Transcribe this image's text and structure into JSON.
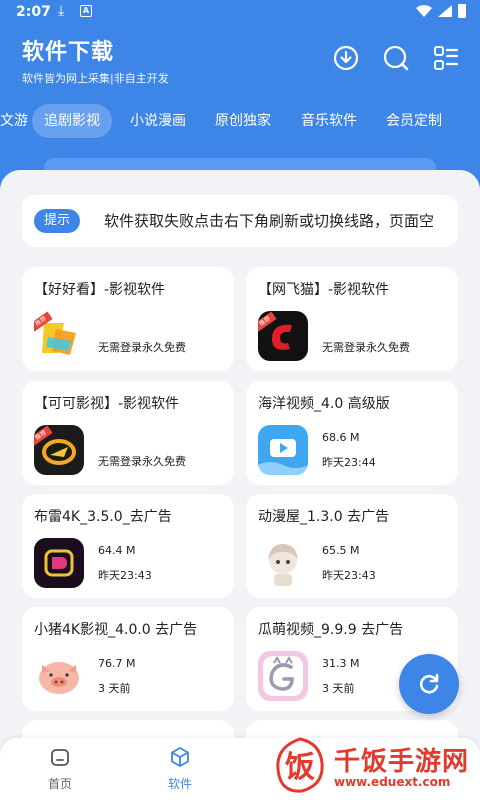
{
  "status_bar": {
    "time": "2:07",
    "a_icon": "A"
  },
  "header": {
    "title": "软件下载",
    "subtitle": "软件皆为网上采集|非自主开发",
    "icons": [
      "download-icon",
      "search-icon",
      "menu-grid-icon"
    ]
  },
  "tabs": [
    {
      "label": "文游"
    },
    {
      "label": "追剧影视",
      "active": true
    },
    {
      "label": "小说漫画"
    },
    {
      "label": "原创独家"
    },
    {
      "label": "音乐软件"
    },
    {
      "label": "会员定制"
    }
  ],
  "notice": {
    "tag": "提示",
    "text": "软件获取失败点击右下角刷新或切换线路，页面空"
  },
  "apps": [
    {
      "name": "【好好看】-影视软件",
      "line1": "",
      "line2": "无需登录永久免费",
      "ribbon": "推荐"
    },
    {
      "name": "【网飞猫】-影视软件",
      "line1": "",
      "line2": "无需登录永久免费",
      "ribbon": "推荐"
    },
    {
      "name": "【可可影视】-影视软件",
      "line1": "",
      "line2": "无需登录永久免费",
      "ribbon": "推荐"
    },
    {
      "name": "海洋视频_4.0 高级版",
      "line1": "68.6 M",
      "line2": "昨天23:44"
    },
    {
      "name": "布雷4K_3.5.0_去广告",
      "line1": "64.4 M",
      "line2": "昨天23:43"
    },
    {
      "name": "动漫屋_1.3.0 去广告",
      "line1": "65.5 M",
      "line2": "昨天23:43"
    },
    {
      "name": "小猪4K影视_4.0.0 去广告",
      "line1": "76.7 M",
      "line2": "3 天前"
    },
    {
      "name": "瓜萌视频_9.9.9 去广告",
      "line1": "31.3 M",
      "line2": "3 天前"
    }
  ],
  "bottom_nav": [
    {
      "label": "首页",
      "icon": "home-icon"
    },
    {
      "label": "软件",
      "icon": "box-icon",
      "active": true
    }
  ],
  "watermark": {
    "brand": "千饭手游网",
    "url": "www.eduext.com",
    "seal_char": "饭"
  },
  "colors": {
    "primary": "#3d86e8",
    "background": "#f1f3f7",
    "watermark": "#e23a2c"
  }
}
